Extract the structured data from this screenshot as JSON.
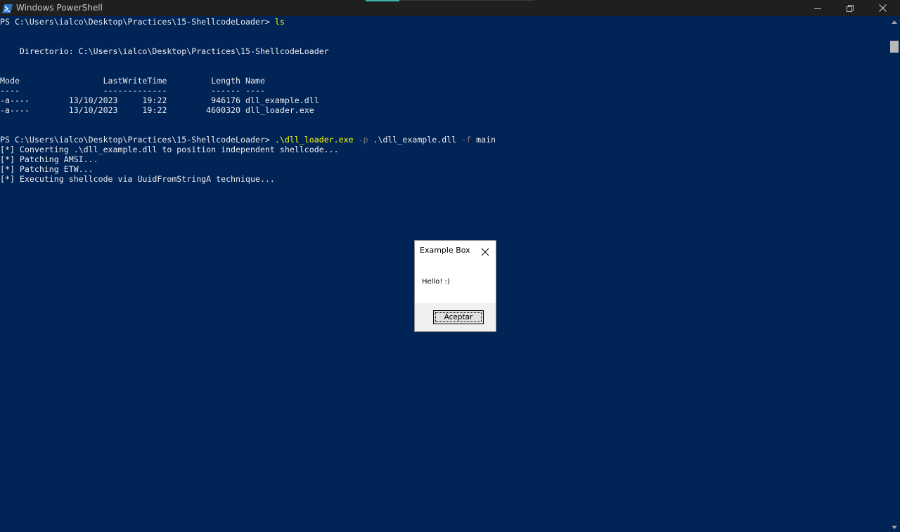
{
  "window": {
    "title": "Windows PowerShell",
    "controls": {
      "minimize_icon": "minimize-icon",
      "maximize_icon": "restore-icon",
      "close_icon": "close-icon"
    }
  },
  "colors": {
    "console_background": "#012456",
    "console_text": "#eeedf0",
    "command_highlight": "#ffff00",
    "parameter_gray": "#7a7a7a",
    "titlebar_background": "#1f1f1f"
  },
  "console": {
    "prompt1": "PS C:\\Users\\ialco\\Desktop\\Practices\\15-ShellcodeLoader> ",
    "command1": "ls",
    "directory_line": "    Directorio: C:\\Users\\ialco\\Desktop\\Practices\\15-ShellcodeLoader",
    "table_header": "Mode                 LastWriteTime         Length Name",
    "table_separator": "----                 -------------         ------ ----",
    "table_rows": [
      "-a----        13/10/2023     19:22         946176 dll_example.dll",
      "-a----        13/10/2023     19:22        4600320 dll_loader.exe"
    ],
    "prompt2": "PS C:\\Users\\ialco\\Desktop\\Practices\\15-ShellcodeLoader> ",
    "command2": {
      "exe": ".\\dll_loader.exe",
      "flag_p": " -p",
      "arg_p": " .\\dll_example.dll",
      "flag_f": " -f",
      "arg_f": " main"
    },
    "output": [
      "[*] Converting .\\dll_example.dll to position independent shellcode...",
      "[*] Patching AMSI...",
      "[*] Patching ETW...",
      "[*] Executing shellcode via UuidFromStringA technique..."
    ]
  },
  "message_box": {
    "title": "Example Box",
    "text": "Hello! :)",
    "button_label": "Aceptar",
    "close_icon": "close-icon"
  }
}
